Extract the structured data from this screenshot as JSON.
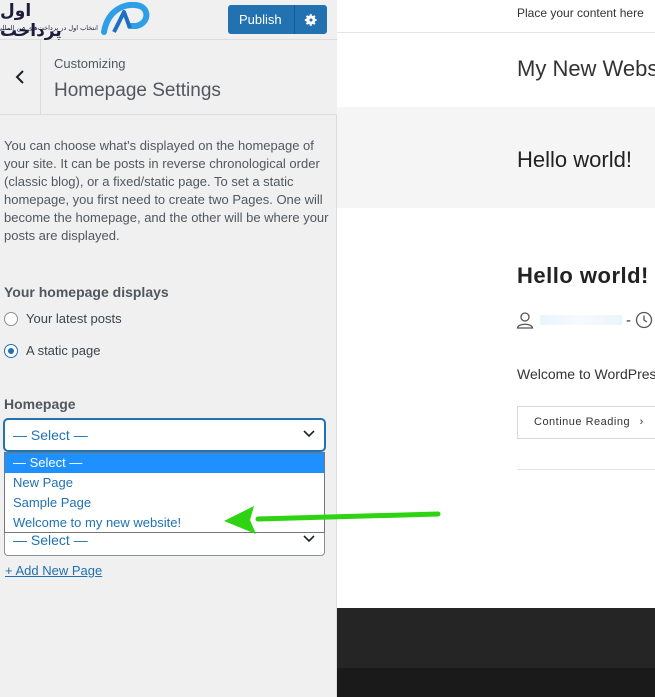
{
  "logo": {
    "text": "اول پرداخت",
    "tagline": "انتخاب اول در پرداخت‌های بین المللی",
    "icon": "ap-logo-icon"
  },
  "topbar": {
    "publish_label": "Publish",
    "settings_icon": "gear-icon"
  },
  "section": {
    "customizing_label": "Customizing",
    "title": "Homepage Settings",
    "back_icon": "chevron-left-icon"
  },
  "description": "You can choose what's displayed on the homepage of your site. It can be posts in reverse chronological order (classic blog), or a fixed/static page. To set a static homepage, you first need to create two Pages. One will become the homepage, and the other will be where your posts are displayed.",
  "homepage_displays": {
    "label": "Your homepage displays",
    "options": [
      {
        "label": "Your latest posts",
        "checked": false
      },
      {
        "label": "A static page",
        "checked": true
      }
    ]
  },
  "homepage_select": {
    "label": "Homepage",
    "value": "— Select —",
    "options": [
      "— Select —",
      "New Page",
      "Sample Page",
      "Welcome to my new website!"
    ],
    "highlighted_index": 0
  },
  "posts_select": {
    "value": "— Select —"
  },
  "add_new_page": "+ Add New Page",
  "preview": {
    "tagline": "Place your content here",
    "site_title": "My New Website",
    "hero_title": "Hello world!",
    "post_title": "Hello world!",
    "excerpt": "Welcome to WordPress. This is your first post.",
    "continue_label": "Continue Reading"
  },
  "colors": {
    "accent": "#2271b1",
    "sidebar_bg": "#f0f0f1",
    "highlight": "#1e90ff",
    "arrow": "#2ed312"
  }
}
